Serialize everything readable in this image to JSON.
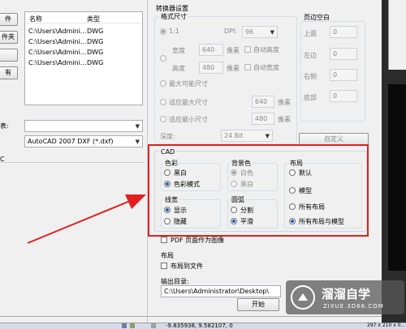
{
  "left": {
    "buttons": [
      "件",
      "件夹",
      "",
      "有"
    ],
    "list": {
      "headers": [
        "名称",
        "类型"
      ],
      "rows": [
        [
          "C:\\Users\\Admini...",
          "DWG"
        ],
        [
          "C:\\Users\\Admini...",
          "DWG"
        ],
        [
          "C:\\Users\\Admini...",
          "DWG"
        ],
        [
          "C:\\Users\\Admini...",
          "DWG"
        ]
      ]
    },
    "table_label": "表:",
    "output_format": "AutoCAD 2007 DXF (*.dxf)",
    "section_label": "C"
  },
  "converter": {
    "title": "转换器设置",
    "format_size_label": "格式尺寸",
    "ratio_label": "1:1",
    "dpi_label": "DPI:",
    "dpi_value": "96",
    "width_label": "宽度",
    "width_value": "640",
    "height_label": "高度",
    "height_value": "480",
    "pixel_unit": "像素",
    "auto_height": "自动高度",
    "auto_width": "自动宽度",
    "max_size_label": "最大可能尺寸",
    "fit_max_label": "适应最大尺寸",
    "fit_max_value": "640",
    "fit_min_label": "适应最小尺寸",
    "fit_min_value": "480",
    "depth_label": "深度:",
    "depth_value": "24 Bit"
  },
  "margins": {
    "title": "页边空白",
    "top_label": "上面",
    "top_value": "0",
    "left_label": "左边",
    "left_value": "0",
    "right_label": "右侧",
    "right_value": "0",
    "bottom_label": "底部",
    "bottom_value": "0",
    "custom_button": "自定义"
  },
  "cad": {
    "title": "CAD",
    "color": {
      "label": "色彩",
      "options": [
        "黑白",
        "色彩模式"
      ],
      "selected": 1
    },
    "background": {
      "label": "背景色",
      "options": [
        "白色",
        "黑白"
      ],
      "selected": 0
    },
    "layout": {
      "label": "布局",
      "options": [
        "默认",
        "模型",
        "所有布局",
        "所有布局与模型"
      ],
      "selected": 3
    },
    "lineweight": {
      "label": "线宽",
      "options": [
        "显示",
        "隐藏"
      ],
      "selected": 0
    },
    "arc": {
      "label": "圆弧",
      "options": [
        "分割",
        "平滑"
      ],
      "selected": 1
    }
  },
  "pdf_layer": "PDF 页面作为图像",
  "layout_section": {
    "title": "布局",
    "checkbox": "布局到文件"
  },
  "output_dir": {
    "label": "输出目录:",
    "value": "C:\\Users\\Administrator\\Desktop\\"
  },
  "start_button": "开始",
  "watermark": {
    "name": "溜溜自学",
    "url": "ZIXUE.3D66.COM"
  },
  "statusbar": {
    "coords": "-9.835938, 9.582107, 0",
    "right_text": "297 x 210 x 0..."
  },
  "colors": {
    "highlight": "#e02020",
    "accent": "#1b55b8"
  }
}
